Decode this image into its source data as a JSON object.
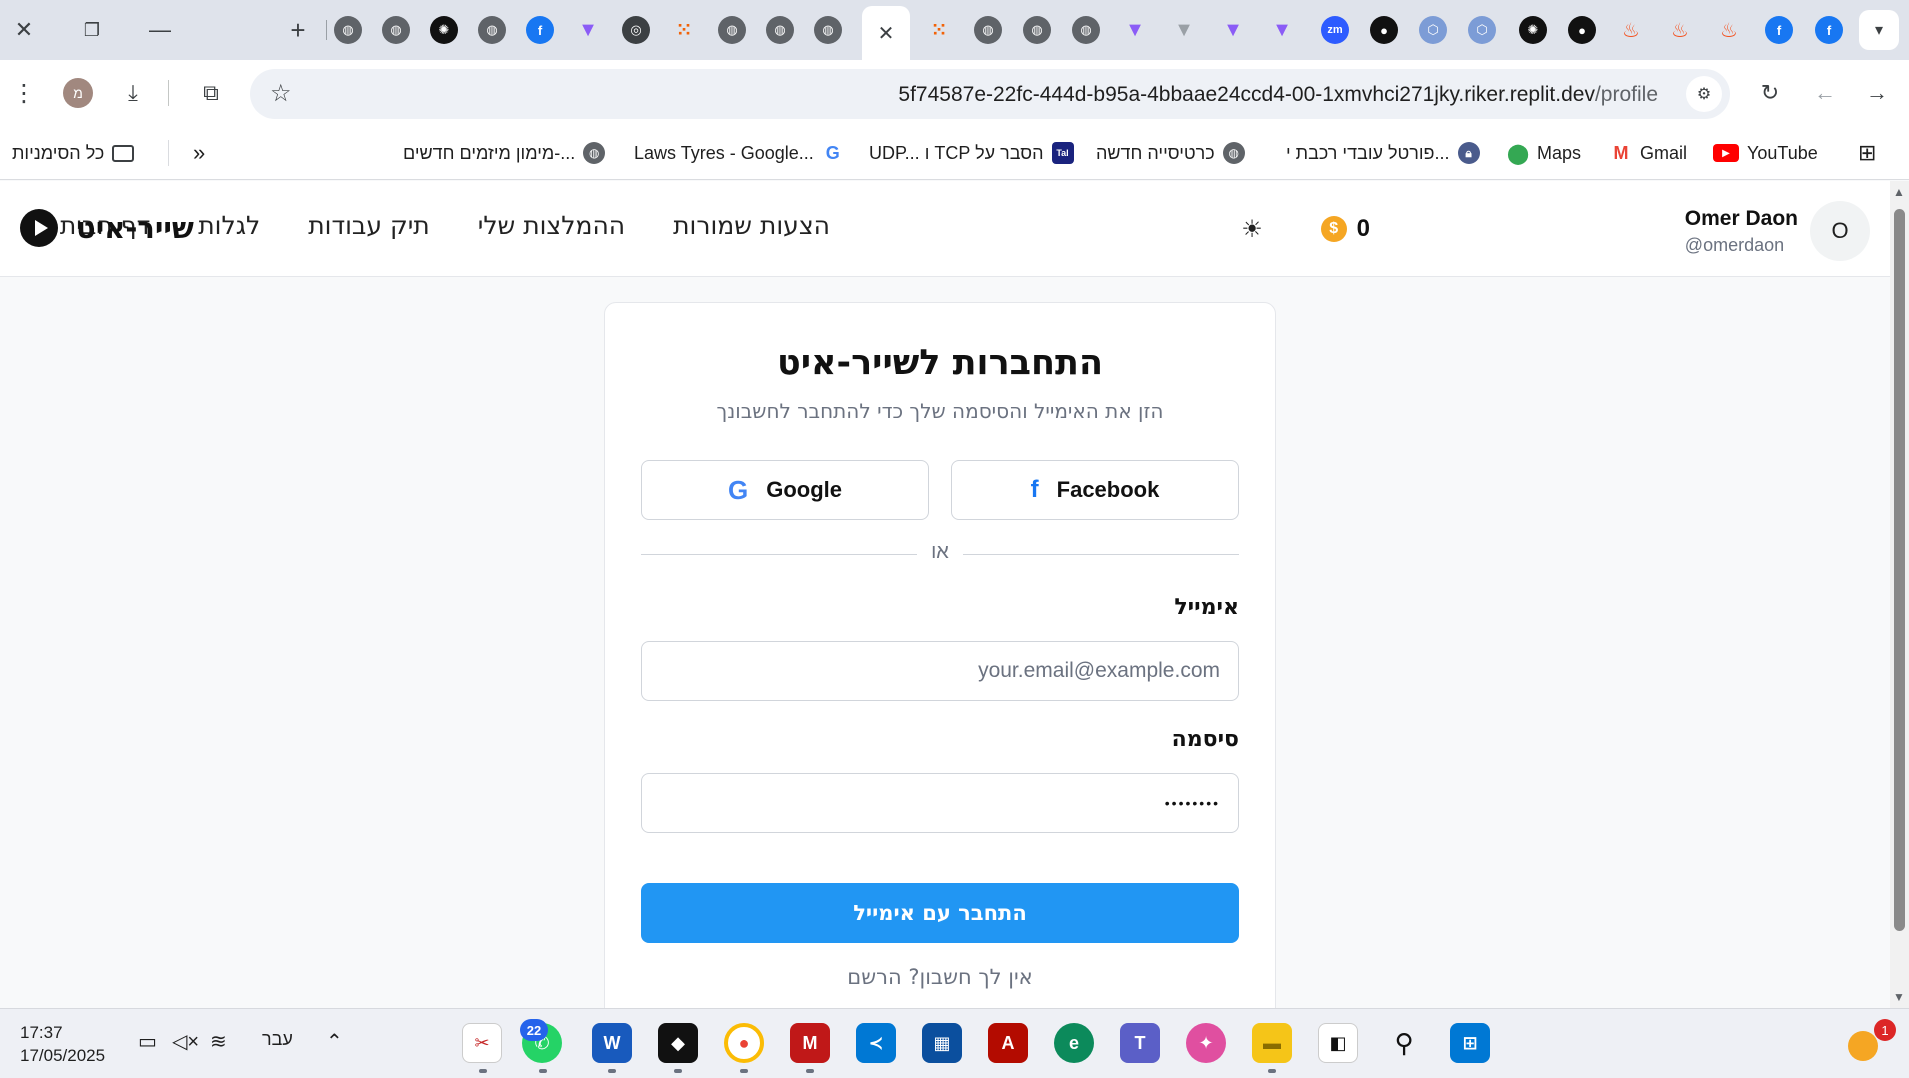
{
  "browser": {
    "tab_icons": [
      "globe",
      "globe",
      "chatgpt",
      "globe",
      "facebook",
      "vite",
      "chrome",
      "replit",
      "globe",
      "globe",
      "globe",
      "replit",
      "globe",
      "globe",
      "globe",
      "vite",
      "vite-gray",
      "vite",
      "vite",
      "zoom",
      "github",
      "hex",
      "hex",
      "chatgpt",
      "github",
      "fire",
      "fire",
      "fire",
      "facebook",
      "facebook"
    ],
    "active_tab_close": "✕",
    "new_tab": "+",
    "profile_initial": "מ",
    "url_host": "5f74587e-22fc-444d-b95a-4bbaae24ccd4-00-1xmvhci271jky.riker.replit.dev",
    "url_path": "/profile",
    "bookmarks": [
      {
        "label": "כל הסימניות",
        "icon": "folder-icon"
      },
      {
        "label": "מימון מיזמים חדשים-...",
        "icon": "globe-icon"
      },
      {
        "label": "Laws Tyres - Google...",
        "icon": "google-icon"
      },
      {
        "label": "UDP... ו TCP הסבר על",
        "icon": "tal-icon"
      },
      {
        "label": "כרטיסייה חדשה",
        "icon": "globe-icon"
      },
      {
        "label": "פורטל עובדי רכבת י...",
        "icon": "lock-icon"
      },
      {
        "label": "Maps",
        "icon": "maps-icon"
      },
      {
        "label": "Gmail",
        "icon": "gmail-icon"
      },
      {
        "label": "YouTube",
        "icon": "youtube-icon"
      }
    ]
  },
  "header": {
    "brand": "שייר-איט",
    "nav": [
      "דף הבית",
      "לגלות",
      "תיק עבודות",
      "ההמלצות שלי",
      "הצעות שמורות"
    ],
    "coins": "0",
    "user_initial": "O",
    "user_name": "Omer Daon",
    "user_handle": "@omerdaon"
  },
  "login": {
    "title": "התחברות לשייר-איט",
    "subtitle": "הזן את האימייל והסיסמה שלך כדי להתחבר לחשבונך",
    "google_label": "Google",
    "facebook_label": "Facebook",
    "divider": "או",
    "email_label": "אימייל",
    "email_placeholder": "your.email@example.com",
    "password_label": "סיסמה",
    "password_value": "••••••••",
    "submit_label": "התחבר עם אימייל",
    "signup_text": "אין לך חשבון? הרשם"
  },
  "taskbar": {
    "time": "17:37",
    "date": "17/05/2025",
    "language": "עבר",
    "whatsapp_badge": "22",
    "notification_count": "1"
  },
  "colors": {
    "primary": "#2196f3",
    "coin": "#f5a623",
    "tabstrip": "#dfe3eb"
  }
}
